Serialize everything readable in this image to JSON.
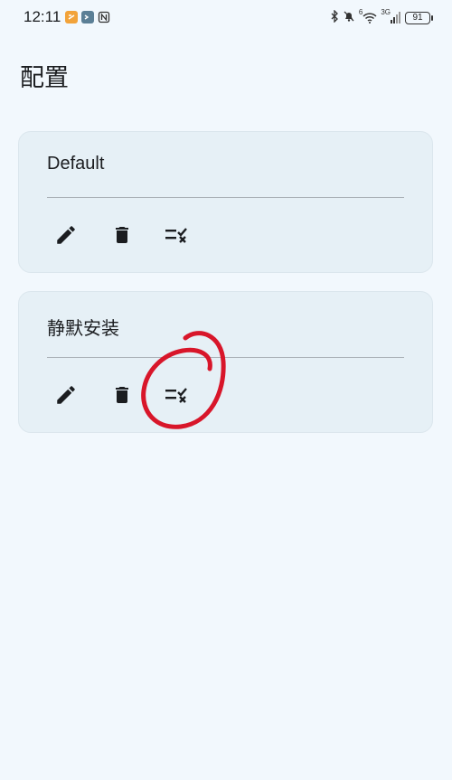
{
  "status_bar": {
    "time": "12:11",
    "network": "3G",
    "wifi_label": "6",
    "battery": "91"
  },
  "page": {
    "title": "配置"
  },
  "configs": [
    {
      "name": "Default"
    },
    {
      "name": "静默安装"
    }
  ],
  "icons": {
    "edit": "pencil-icon",
    "delete": "trash-icon",
    "batch": "checklist-icon"
  },
  "colors": {
    "background": "#f2f8fd",
    "card": "#e6f0f6",
    "annotation": "#d8162a"
  }
}
